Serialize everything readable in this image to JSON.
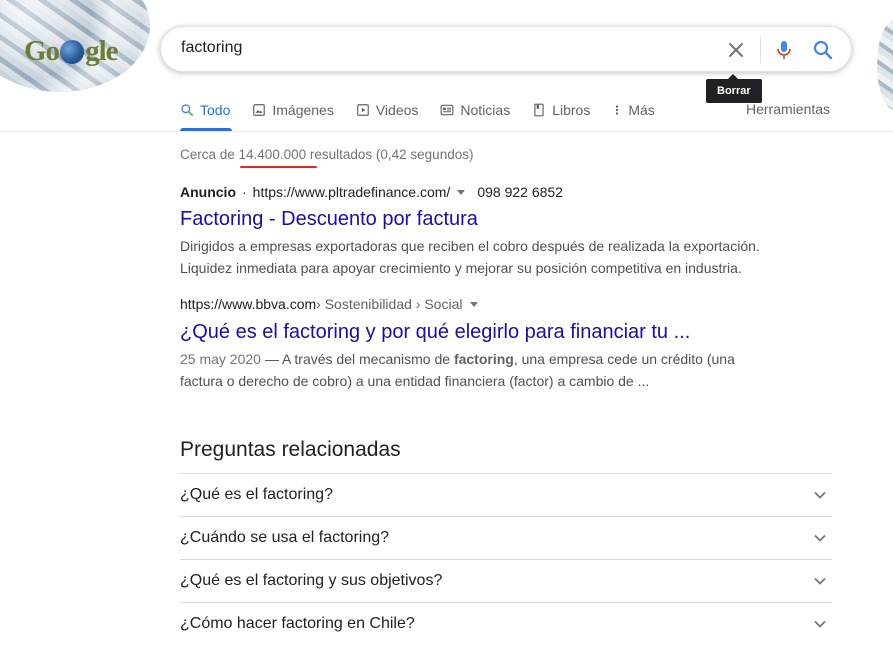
{
  "logo": {
    "text_a": "Go",
    "text_b": "gle"
  },
  "search": {
    "query": "factoring"
  },
  "tooltip": {
    "clear": "Borrar"
  },
  "tabs": [
    {
      "label": "Todo",
      "icon": "search-icon",
      "active": true
    },
    {
      "label": "Imágenes",
      "icon": "image-icon"
    },
    {
      "label": "Videos",
      "icon": "video-icon"
    },
    {
      "label": "Noticias",
      "icon": "news-icon"
    },
    {
      "label": "Libros",
      "icon": "book-icon"
    },
    {
      "label": "Más",
      "icon": "more-vert-icon"
    }
  ],
  "tools_label": "Herramientas",
  "stats": {
    "prefix": "Cerca de ",
    "count": "14.400.000",
    "suffix": " resultados (0,42 segundos)"
  },
  "ad": {
    "label": "Anuncio",
    "dot": "·",
    "url": "https://www.pltradefinance.com/",
    "phone": "098 922 6852",
    "title": "Factoring - Descuento por factura",
    "snippet_1": "Dirigidos a empresas exportadoras que reciben el cobro después de realizada la exportación.",
    "snippet_2": "Liquidez inmediata para apoyar crecimiento y mejorar su posición competitiva en industria."
  },
  "result": {
    "domain": "https://www.bbva.com",
    "path": " › Sostenibilidad › Social",
    "title": "¿Qué es el factoring y por qué elegirlo para financiar tu ...",
    "date": "25 may 2020",
    "dash": " — A través del mecanismo de ",
    "keyword": "factoring",
    "snippet_rest": ", una empresa cede un crédito (una",
    "snippet_2": "factura o derecho de cobro) a una entidad financiera (factor) a cambio de ..."
  },
  "related": {
    "title": "Preguntas relacionadas",
    "questions": [
      "¿Qué es el factoring?",
      "¿Cuándo se usa el factoring?",
      "¿Qué es el factoring y sus objetivos?",
      "¿Cómo hacer factoring en Chile?"
    ]
  },
  "colors": {
    "accent": "#1a73e8",
    "link": "#1a0dab",
    "underline_annotation": "#e0281e"
  }
}
